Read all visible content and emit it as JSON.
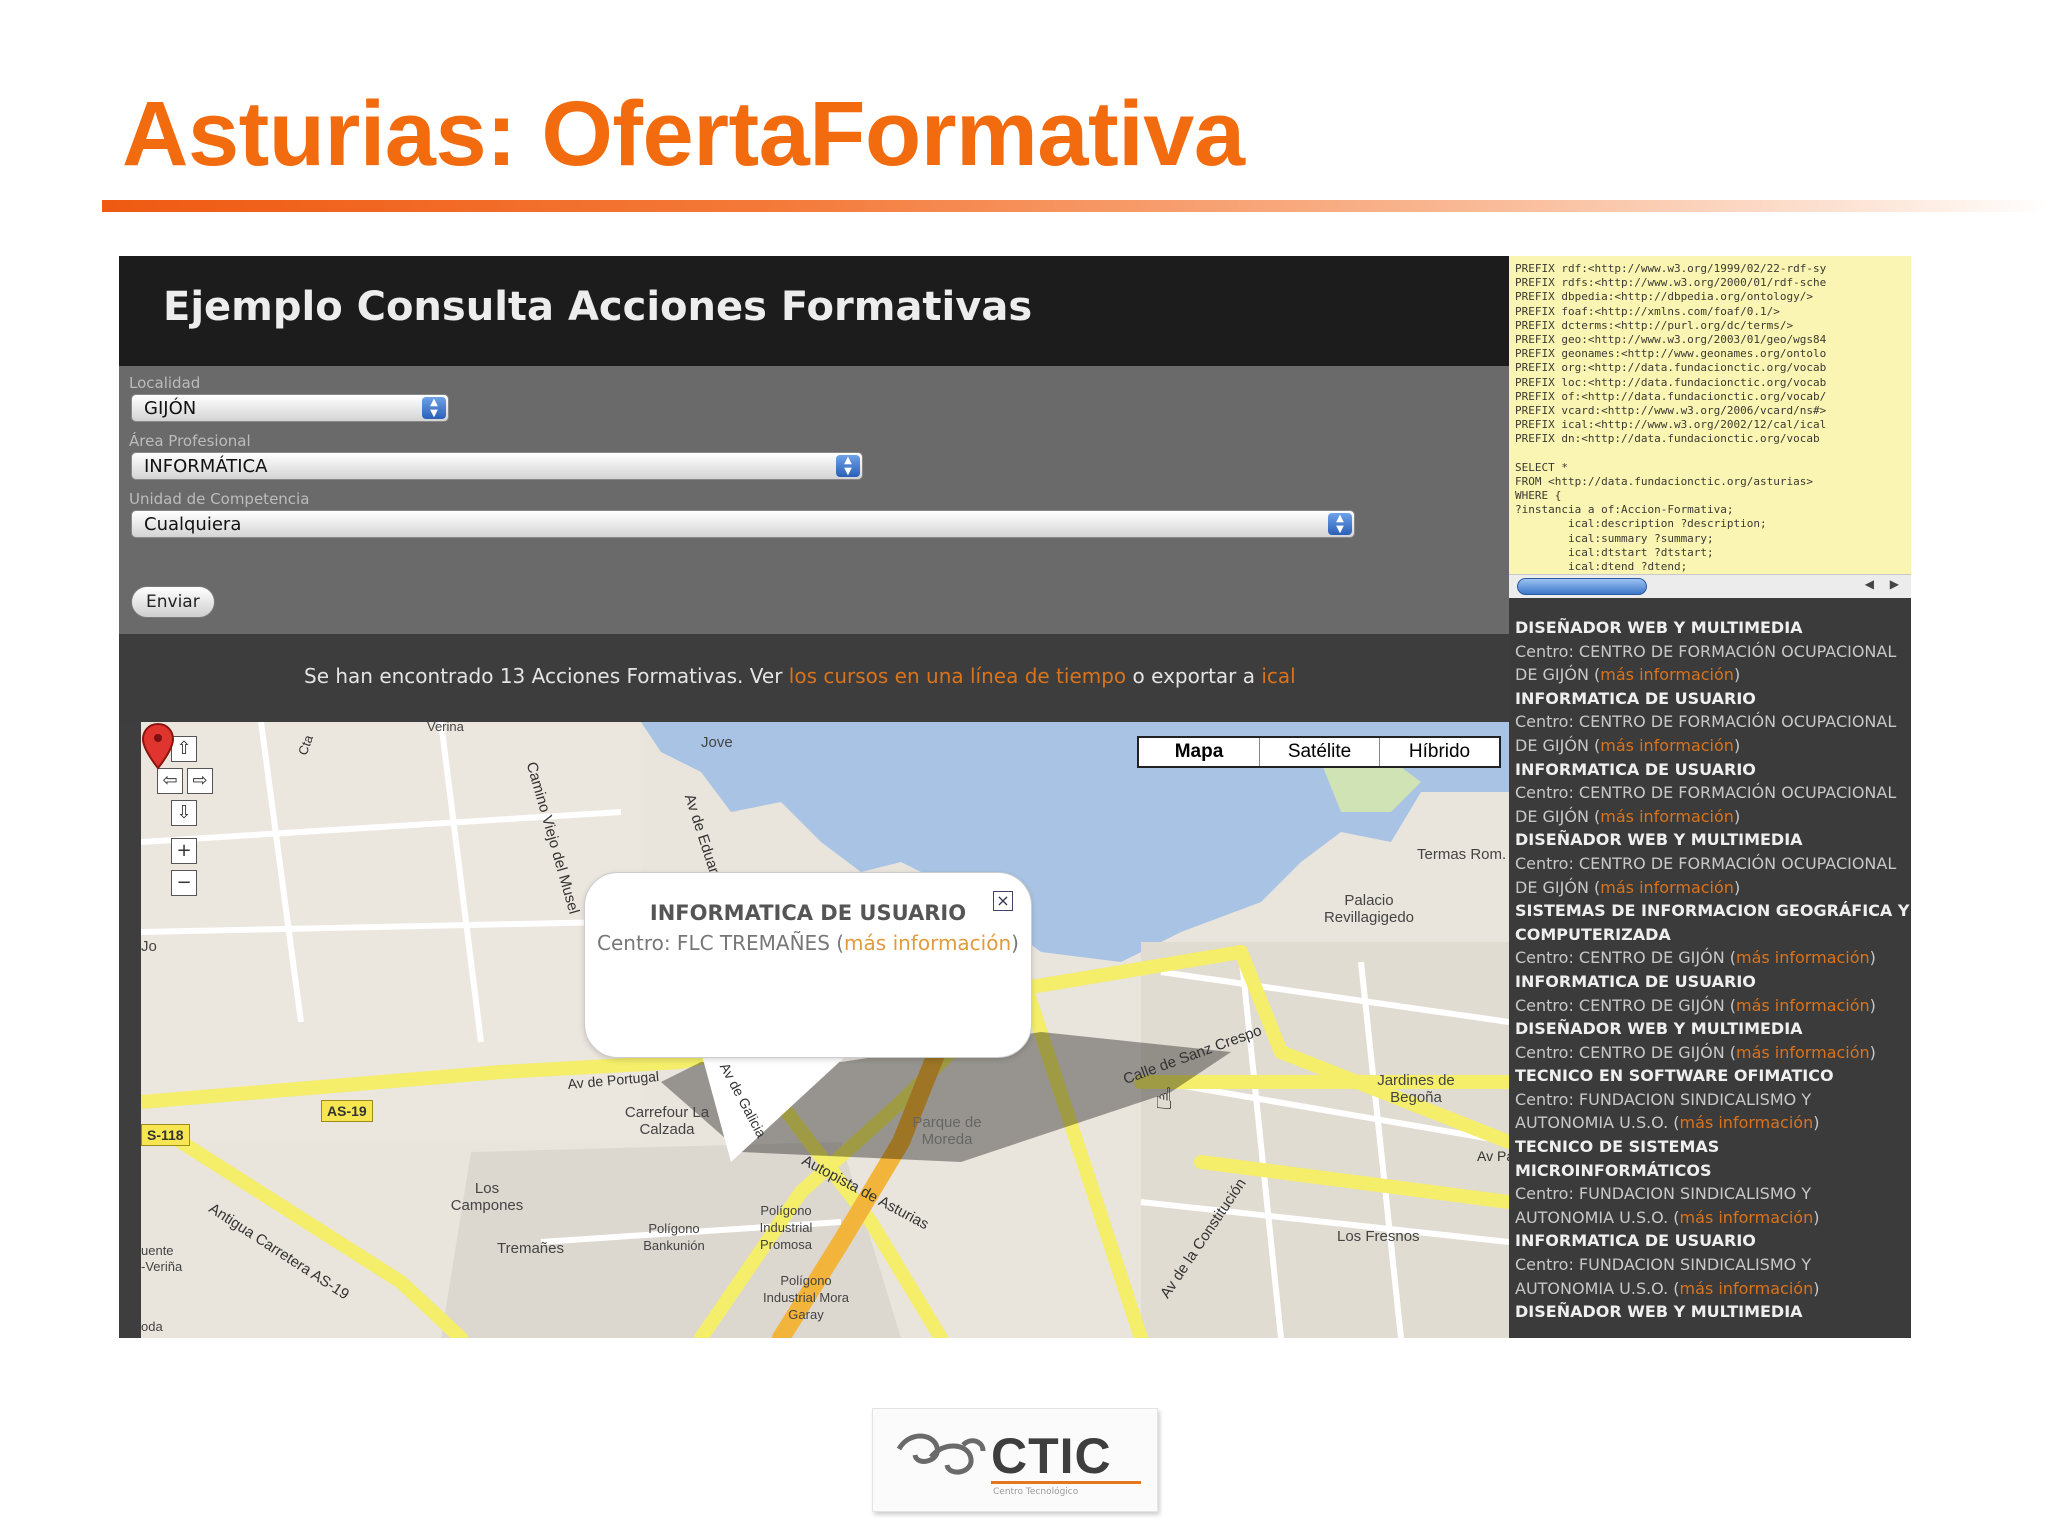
{
  "slide": {
    "title": "Asturias: OfertaFormativa"
  },
  "app": {
    "title": "Ejemplo Consulta Acciones Formativas",
    "form": {
      "localidad_label": "Localidad",
      "localidad_value": "GIJÓN",
      "area_label": "Área Profesional",
      "area_value": "INFORMÁTICA",
      "unidad_label": "Unidad de Competencia",
      "unidad_value": "Cualquiera",
      "submit_label": "Enviar"
    },
    "result": {
      "prefix": "Se han encontrado 13 Acciones Formativas. Ver ",
      "link_view": "los cursos en una línea de tiempo",
      "middle": " o exportar a ",
      "link_export": "ical"
    }
  },
  "map": {
    "types": [
      "Mapa",
      "Satélite",
      "Híbrido"
    ],
    "active_type": "Mapa",
    "nav": {
      "up": "⇧",
      "left": "⇦",
      "right": "⇨",
      "down": "⇩",
      "zoom_in": "+",
      "zoom_out": "−"
    },
    "info_window": {
      "title": "INFORMATICA DE USUARIO",
      "center_prefix": "Centro: FLC TREMAÑES (",
      "link": "más información",
      "center_suffix": ")",
      "close": "×"
    },
    "places": [
      "Jove",
      "Av de Eduardo",
      "Camino Viejo del Musel",
      "Termas Rom. de Campo V",
      "Palacio Revillagigedo",
      "Calle de Sanz Crespo",
      "Jardines de Begoña",
      "Carrefour La Calzada",
      "Parque de Moreda",
      "Los Campones",
      "Tremañes",
      "Polígono Bankunión",
      "Polígono Industrial Promosa",
      "Polígono Industrial Mora Garay",
      "Los Fresnos",
      "Antigua Carretera AS-19",
      "Av de la Constitución",
      "Av de Portugal",
      "Av de Galicia",
      "Autopista de Asturias",
      "Av Pablo Iglesias",
      "Verina",
      "Cta",
      "Jo",
      "uente",
      "-Veriña",
      "oda"
    ],
    "shields": [
      "AS-19",
      "S-118"
    ]
  },
  "query": {
    "lines": [
      "PREFIX rdf:<http://www.w3.org/1999/02/22-rdf-sy",
      "PREFIX rdfs:<http://www.w3.org/2000/01/rdf-sche",
      "PREFIX dbpedia:<http://dbpedia.org/ontology/>",
      "PREFIX foaf:<http://xmlns.com/foaf/0.1/>",
      "PREFIX dcterms:<http://purl.org/dc/terms/>",
      "PREFIX geo:<http://www.w3.org/2003/01/geo/wgs84",
      "PREFIX geonames:<http://www.geonames.org/ontolo",
      "PREFIX org:<http://data.fundacionctic.org/vocab",
      "PREFIX loc:<http://data.fundacionctic.org/vocab",
      "PREFIX of:<http://data.fundacionctic.org/vocab/",
      "PREFIX vcard:<http://www.w3.org/2006/vcard/ns#>",
      "PREFIX ical:<http://www.w3.org/2002/12/cal/ical",
      "PREFIX dn:<http://data.fundacionctic.org/vocab",
      "",
      "SELECT *",
      "FROM <http://data.fundacionctic.org/asturias>",
      "WHERE {",
      "?instancia a of:Accion-Formativa;",
      "        ical:description ?description;",
      "        ical:summary ?summary;",
      "        ical:dtstart ?dtstart;",
      "        ical:dtend ?dtend;"
    ],
    "scroll_arrows": "◀ ▶"
  },
  "results": [
    {
      "title": "DISEÑADOR WEB Y MULTIMEDIA",
      "center": "Centro: CENTRO DE FORMACIÓN OCUPACIONAL DE GIJÓN",
      "link": "más información"
    },
    {
      "title": "INFORMATICA DE USUARIO",
      "center": "Centro: CENTRO DE FORMACIÓN OCUPACIONAL DE GIJÓN",
      "link": "más información"
    },
    {
      "title": "INFORMATICA DE USUARIO",
      "center": "Centro: CENTRO DE FORMACIÓN OCUPACIONAL DE GIJÓN",
      "link": "más información"
    },
    {
      "title": "DISEÑADOR WEB Y MULTIMEDIA",
      "center": "Centro: CENTRO DE FORMACIÓN OCUPACIONAL DE GIJÓN",
      "link": "más información"
    },
    {
      "title": "SISTEMAS DE INFORMACION GEOGRÁFICA Y COMPUTERIZADA",
      "center": "Centro: CENTRO DE GIJÓN",
      "link": "más información"
    },
    {
      "title": "INFORMATICA DE USUARIO",
      "center": "Centro: CENTRO DE GIJÓN",
      "link": "más información"
    },
    {
      "title": "DISEÑADOR WEB Y MULTIMEDIA",
      "center": "Centro: CENTRO DE GIJÓN",
      "link": "más información"
    },
    {
      "title": "TECNICO EN SOFTWARE OFIMATICO",
      "center": "Centro: FUNDACION SINDICALISMO Y AUTONOMIA U.S.O.",
      "link": "más información"
    },
    {
      "title": "TECNICO DE SISTEMAS MICROINFORMÁTICOS",
      "center": "Centro: FUNDACION SINDICALISMO Y AUTONOMIA U.S.O.",
      "link": "más información"
    },
    {
      "title": "INFORMATICA DE USUARIO",
      "center": "Centro: FUNDACION SINDICALISMO Y AUTONOMIA U.S.O.",
      "link": "más información"
    },
    {
      "title": "DISEÑADOR WEB Y MULTIMEDIA",
      "center": "",
      "link": ""
    }
  ],
  "logo": {
    "name": "CTIC",
    "tagline": "Centro Tecnológico"
  },
  "colors": {
    "title_orange": "#f26b0f",
    "link_orange": "#d9731c",
    "road_yellow": "#f4ee6a",
    "water_blue": "#a9c3e4"
  }
}
